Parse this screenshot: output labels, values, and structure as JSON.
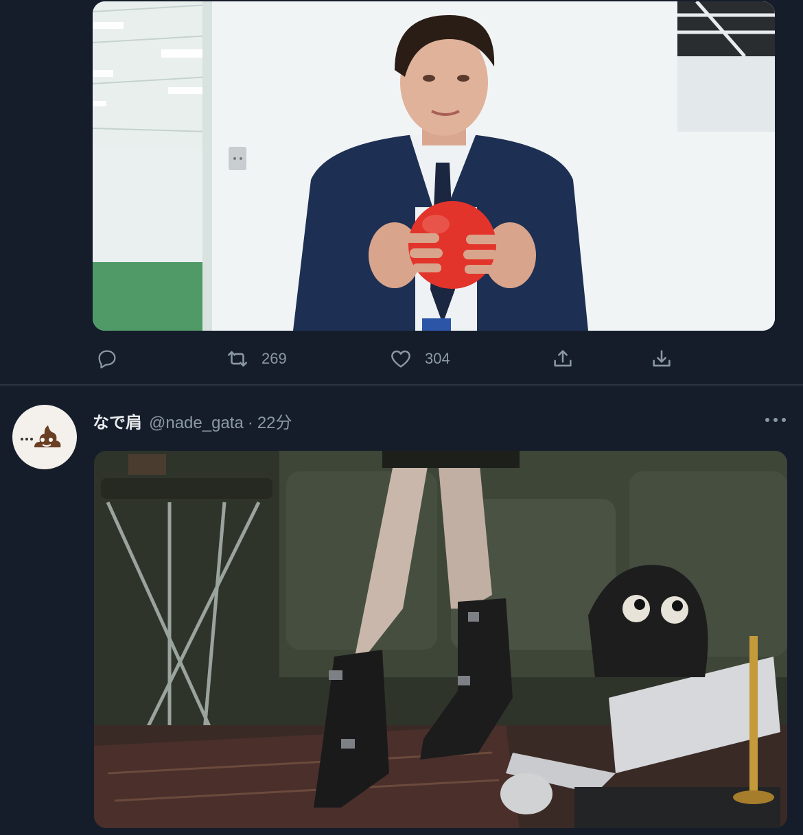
{
  "tweet_top": {
    "media_alt": "Man in navy suit holding a red ball in a white office",
    "actions": {
      "reply_count": "",
      "retweet_count": "269",
      "like_count": "304"
    }
  },
  "tweet_bottom": {
    "display_name": "なで肩",
    "handle": "@nade_gata",
    "separator": "·",
    "time": "22分",
    "media_alt": "Legs in black buckled boots sitting on a green sofa beside a laptop"
  },
  "colors": {
    "background": "#151d2b",
    "muted_text": "#8b98a5",
    "primary_text": "#e7e9ea",
    "ball_red": "#e2342b"
  }
}
